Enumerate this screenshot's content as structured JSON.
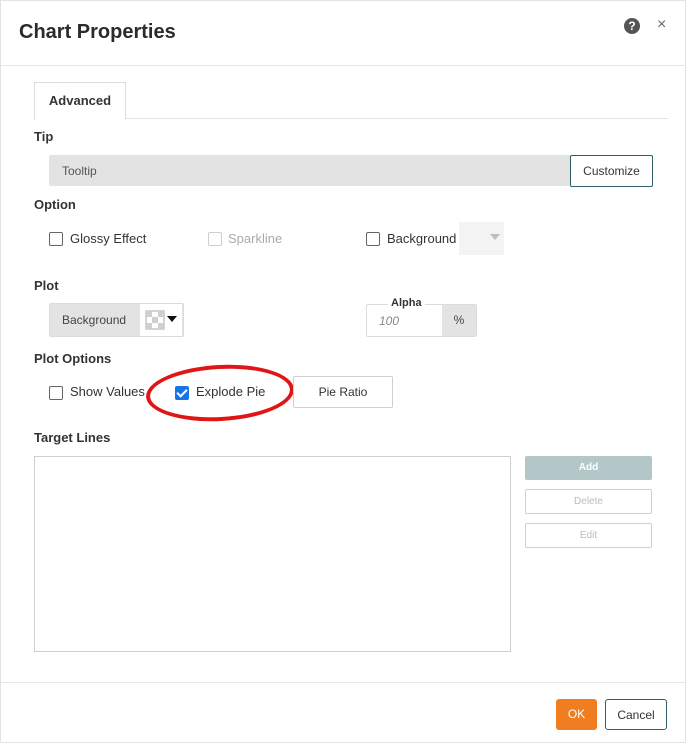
{
  "dialog": {
    "title": "Chart Properties"
  },
  "tabs": [
    {
      "label": "Advanced"
    }
  ],
  "tip": {
    "section": "Tip",
    "tooltip_value": "Tooltip",
    "customize_label": "Customize"
  },
  "option": {
    "section": "Option",
    "glossy": {
      "label": "Glossy Effect",
      "checked": false
    },
    "sparkline": {
      "label": "Sparkline",
      "checked": false,
      "disabled": true
    },
    "background": {
      "label": "Background",
      "checked": false
    }
  },
  "plot": {
    "section": "Plot",
    "background_label": "Background",
    "alpha_label": "Alpha",
    "alpha_placeholder": "100",
    "alpha_unit": "%"
  },
  "plot_options": {
    "section": "Plot Options",
    "show_values": {
      "label": "Show Values",
      "checked": false
    },
    "explode_pie": {
      "label": "Explode Pie",
      "checked": true
    },
    "pie_ratio_label": "Pie Ratio"
  },
  "target_lines": {
    "section": "Target Lines",
    "add_label": "Add",
    "delete_label": "Delete",
    "edit_label": "Edit"
  },
  "footer": {
    "ok_label": "OK",
    "cancel_label": "Cancel"
  },
  "colors": {
    "accent": "#f07d1f",
    "highlight": "#e01515",
    "checkbox_checked": "#1a73e8"
  }
}
